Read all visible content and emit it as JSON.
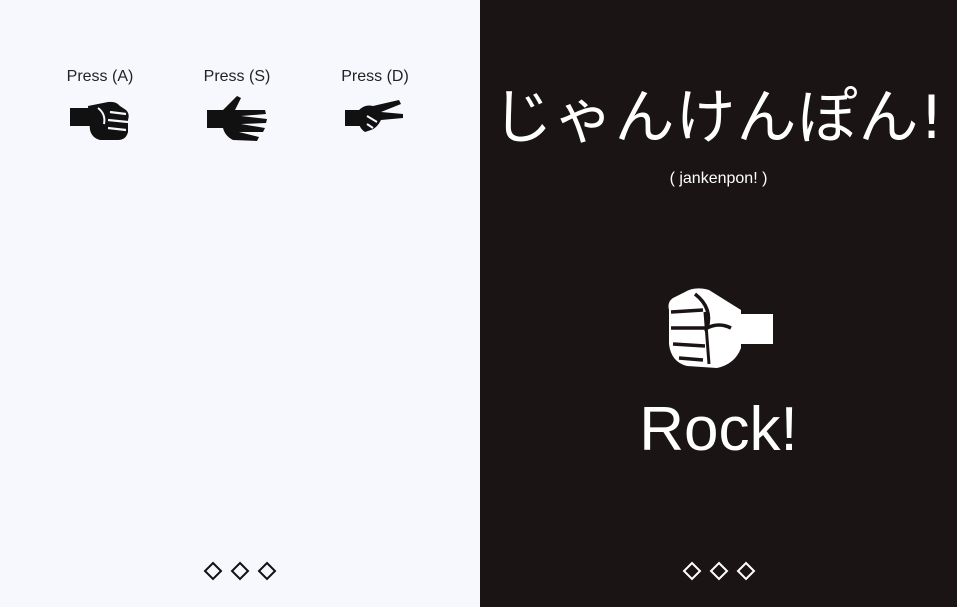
{
  "game": {
    "title": "じゃんけんぽん!",
    "subtitle": "( jankenpon! )"
  },
  "choices": [
    {
      "label": "Press (A)",
      "icon": "rock-hand-icon"
    },
    {
      "label": "Press (S)",
      "icon": "paper-hand-icon"
    },
    {
      "label": "Press (D)",
      "icon": "scissors-hand-icon"
    }
  ],
  "opponent": {
    "choice_icon": "rock-hand-icon",
    "result_text": "Rock!"
  },
  "score": {
    "player_wins": 0,
    "opponent_wins": 0,
    "max_points": 3
  },
  "colors": {
    "player_background": "#f7f8fe",
    "opponent_background": "#1a1514",
    "ink_dark": "#111111",
    "ink_light": "#ffffff"
  }
}
